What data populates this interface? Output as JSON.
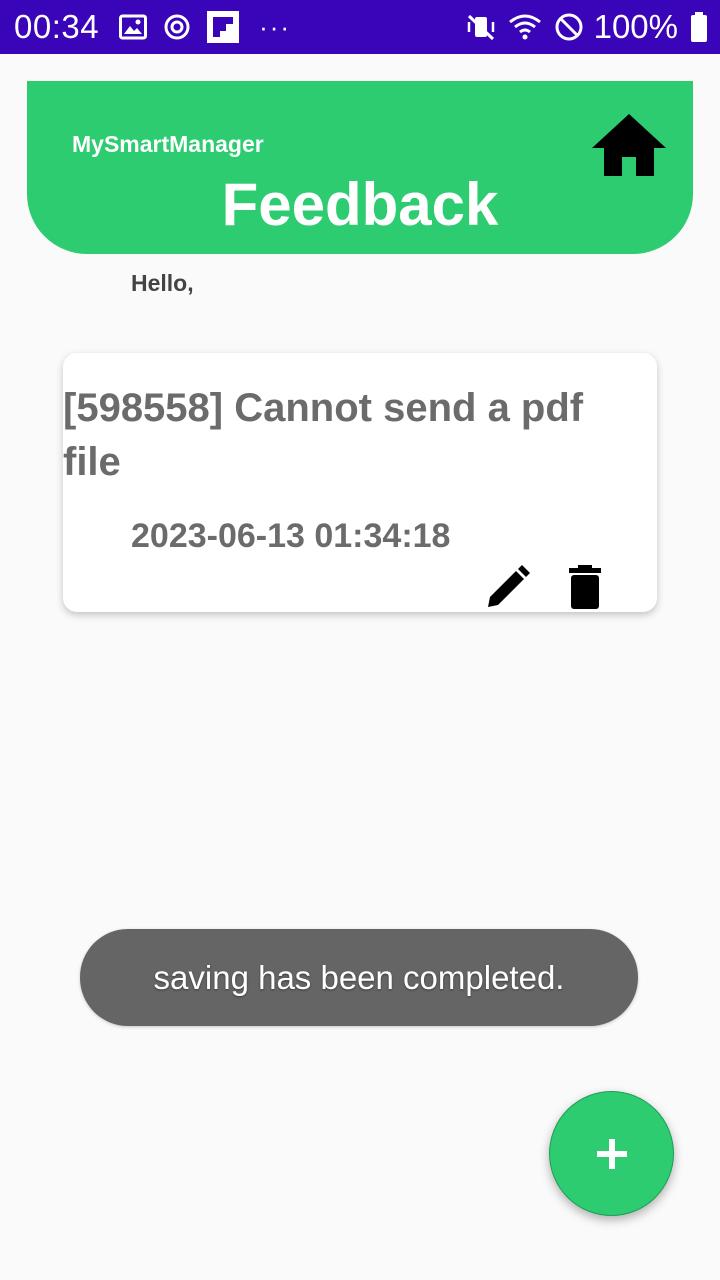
{
  "status_bar": {
    "time": "00:34",
    "battery": "100%",
    "more": "···",
    "background": "#3a04b8"
  },
  "header": {
    "app_name": "MySmartManager",
    "title": "Feedback",
    "accent": "#2ecc71",
    "home_icon": "home-icon"
  },
  "greeting": "Hello,",
  "feedback_list": [
    {
      "title": "[598558] Cannot send a pdf file",
      "date": "2023-06-13 01:34:18",
      "edit_icon": "pencil-icon",
      "delete_icon": "trash-icon"
    }
  ],
  "toast": {
    "message": "saving has been completed."
  },
  "fab": {
    "icon": "plus-icon"
  }
}
